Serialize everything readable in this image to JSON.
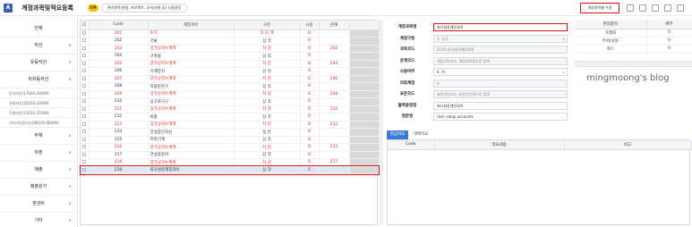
{
  "header": {
    "app_icon": "A",
    "title": "계정과목및적요등록",
    "tip_badge": "TIP",
    "tip_text": "관리항목(현장, 프로젝트, 부서/사원 등) 사용설정",
    "help_button": "계정과목별 수정"
  },
  "sidebar": {
    "items": [
      {
        "label": "전체",
        "kind": "main",
        "chev": ""
      },
      {
        "label": "자산",
        "kind": "main",
        "chev": "∨"
      },
      {
        "label": "유동자산",
        "kind": "main",
        "chev": "∨"
      },
      {
        "label": "비유동자산",
        "kind": "main",
        "chev": "∧"
      },
      {
        "label": "투자자산(17600-20099)",
        "kind": "sub",
        "chev": ""
      },
      {
        "label": "유형자산(20100-23099)",
        "kind": "sub",
        "chev": ""
      },
      {
        "label": "무형자산(23100-25099)",
        "kind": "sub",
        "chev": ""
      },
      {
        "label": "기타비유동자산(96100-98099)",
        "kind": "sub",
        "chev": ""
      },
      {
        "label": "부채",
        "kind": "main",
        "chev": "∨"
      },
      {
        "label": "자본",
        "kind": "main",
        "chev": "∨"
      },
      {
        "label": "매출",
        "kind": "main",
        "chev": "∨"
      },
      {
        "label": "매출원가",
        "kind": "main",
        "chev": "∨"
      },
      {
        "label": "판관비",
        "kind": "main",
        "chev": "∨"
      },
      {
        "label": "기타",
        "kind": "main",
        "chev": "∨"
      }
    ]
  },
  "grid": {
    "columns": [
      "Code",
      "계정과목",
      "구분",
      "사용",
      "관계"
    ],
    "rows": [
      {
        "code": "201",
        "name": "토지",
        "type": "차 감 액",
        "use": "O",
        "rel": "",
        "red": true
      },
      {
        "code": "202",
        "name": "건물",
        "type": "상 각",
        "use": "O",
        "rel": "",
        "red": false
      },
      {
        "code": "203",
        "name": "감가상각누계액",
        "type": "차 감",
        "use": "O",
        "rel": "202",
        "red": true
      },
      {
        "code": "204",
        "name": "구축물",
        "type": "상 각",
        "use": "O",
        "rel": "",
        "red": false
      },
      {
        "code": "205",
        "name": "감가상각누계액",
        "type": "차 감",
        "use": "O",
        "rel": "204",
        "red": true
      },
      {
        "code": "206",
        "name": "기계장치",
        "type": "상 각",
        "use": "O",
        "rel": "",
        "red": false
      },
      {
        "code": "207",
        "name": "감가상각누계액",
        "type": "차 감",
        "use": "O",
        "rel": "206",
        "red": true
      },
      {
        "code": "208",
        "name": "차량운반구",
        "type": "상 각",
        "use": "O",
        "rel": "",
        "red": false
      },
      {
        "code": "209",
        "name": "감가상각누계액",
        "type": "차 감",
        "use": "O",
        "rel": "208",
        "red": true
      },
      {
        "code": "210",
        "name": "공구와기구",
        "type": "상 각",
        "use": "O",
        "rel": "",
        "red": false
      },
      {
        "code": "211",
        "name": "감가상각누계액",
        "type": "차 감",
        "use": "O",
        "rel": "210",
        "red": true
      },
      {
        "code": "212",
        "name": "비품",
        "type": "상 각",
        "use": "O",
        "rel": "",
        "red": false
      },
      {
        "code": "213",
        "name": "감가상각누계액",
        "type": "차 감",
        "use": "O",
        "rel": "212",
        "red": true
      },
      {
        "code": "214",
        "name": "건설중인자산",
        "type": "일 반",
        "use": "O",
        "rel": "",
        "red": false
      },
      {
        "code": "215",
        "name": "미착기계",
        "type": "상 각",
        "use": "O",
        "rel": "",
        "red": false
      },
      {
        "code": "216",
        "name": "감가상각누계액",
        "type": "차 감",
        "use": "O",
        "rel": "215",
        "red": true
      },
      {
        "code": "217",
        "name": "건설용장비",
        "type": "상 각",
        "use": "O",
        "rel": "",
        "red": false
      },
      {
        "code": "218",
        "name": "감가상각누계액",
        "type": "차 감",
        "use": "O",
        "rel": "217",
        "red": true
      },
      {
        "code": "219",
        "name": "회사설정계정과목",
        "type": "상 각",
        "use": "O",
        "rel": "",
        "red": false,
        "selected": true
      }
    ]
  },
  "form": {
    "fields": [
      {
        "label": "계정과목명",
        "value": "회사설정계정과목",
        "readonly": false,
        "highlight": true,
        "dropdown": false
      },
      {
        "label": "계정구분",
        "value": "1. 상각",
        "readonly": true,
        "highlight": false,
        "dropdown": true
      },
      {
        "label": "과목코드",
        "value": "[219] 회사설정계정과목",
        "readonly": true,
        "highlight": false,
        "dropdown": false
      },
      {
        "label": "관계코드",
        "value": "계정과목코드, 계정과목명으로 검색",
        "readonly": true,
        "highlight": false,
        "dropdown": false
      },
      {
        "label": "사용여부",
        "value": "0. 여",
        "readonly": false,
        "highlight": false,
        "dropdown": true
      },
      {
        "label": "외화계정",
        "value": "0",
        "readonly": true,
        "highlight": false,
        "dropdown": false
      },
      {
        "label": "표준코드",
        "value": "표준산업코드, 표준산업명으로 검색",
        "readonly": true,
        "highlight": false,
        "dropdown": false
      },
      {
        "label": "출력용명칭",
        "value": "회사설정계정과목",
        "readonly": false,
        "highlight": false,
        "dropdown": false
      },
      {
        "label": "영문명",
        "value": "User setup accounts",
        "readonly": false,
        "highlight": false,
        "dropdown": false
      }
    ]
  },
  "mgmt": {
    "columns": [
      "관리항목",
      "여부"
    ],
    "rows": [
      {
        "item": "거래처",
        "flag": "O"
      },
      {
        "item": "부서/사원",
        "flag": "O"
      },
      {
        "item": "카드",
        "flag": "O"
      }
    ]
  },
  "watermark": "mingmoong's blog",
  "tabs": [
    "현금적요",
    "대체적요"
  ],
  "subgrid": {
    "columns": [
      "Code",
      "적요내용",
      "비고"
    ]
  }
}
